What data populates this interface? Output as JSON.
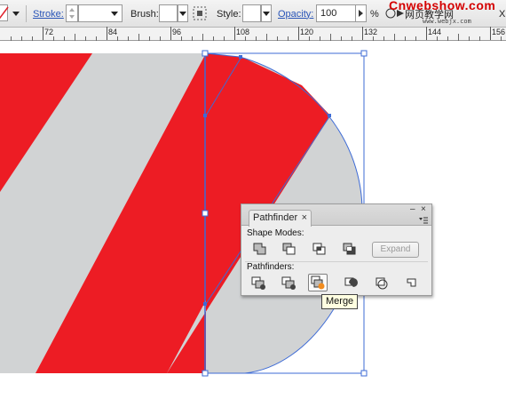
{
  "control_bar": {
    "stroke_label": "Stroke:",
    "brush_label": "Brush:",
    "style_label": "Style:",
    "opacity_label": "Opacity:",
    "opacity_value": "100",
    "opacity_unit": "%",
    "close_label": "X"
  },
  "ruler": {
    "labels": [
      "72",
      "84",
      "96",
      "108",
      "120",
      "132",
      "144",
      "156"
    ]
  },
  "artwork": {
    "stripe_red": "#ed1c24",
    "stripe_gray": "#d1d3d4",
    "selection_blue": "#3d6bd6"
  },
  "pathfinder": {
    "tab_label": "Pathfinder",
    "tab_close": "×",
    "minimize": "–",
    "close": "×",
    "shape_modes_label": "Shape Modes:",
    "expand_label": "Expand",
    "pathfinders_label": "Pathfinders:",
    "shape_mode_icons": [
      "unite-icon",
      "minus-front-icon",
      "intersect-icon",
      "exclude-icon"
    ],
    "pathfinder_icons": [
      "divide-icon",
      "trim-icon",
      "merge-icon",
      "crop-icon",
      "outline-icon",
      "minus-back-icon"
    ],
    "selected": "merge-icon"
  },
  "tooltip": {
    "text": "Merge"
  },
  "watermark": {
    "main": "Cnwebshow.com",
    "chinese": "网页教学网",
    "sub": "www.webjx.com"
  }
}
